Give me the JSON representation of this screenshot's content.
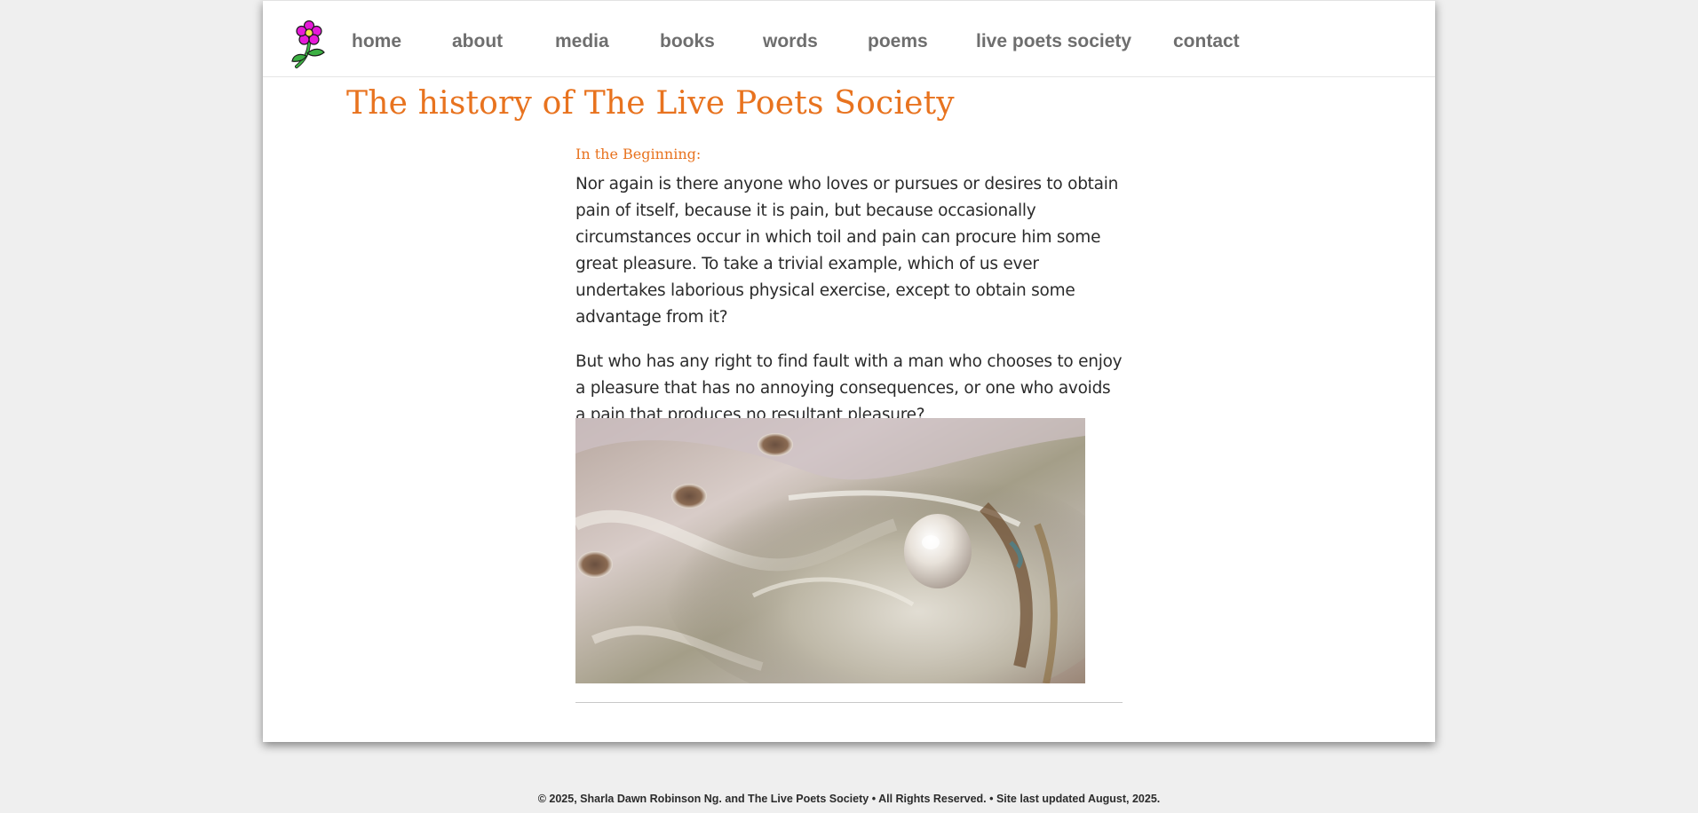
{
  "nav": {
    "logo_icon": "flower-icon",
    "items": [
      {
        "label": "home"
      },
      {
        "label": "about"
      },
      {
        "label": "media"
      },
      {
        "label": "books"
      },
      {
        "label": "words"
      },
      {
        "label": "poems"
      },
      {
        "label": "live poets society"
      },
      {
        "label": "contact"
      }
    ]
  },
  "main": {
    "title": "The history of The Live Poets Society",
    "section_heading": "In the Beginning:",
    "paragraphs": [
      "Nor again is there anyone who loves or pursues or desires to obtain pain of itself, because it is pain, but because occasionally circumstances occur in which toil and pain can procure him some great pleasure. To take a trivial example, which of us ever undertakes laborious physical exercise, except to obtain some advantage from it?",
      "But who has any right to find fault with a man who chooses to enjoy a pleasure that has no annoying consequences, or one who avoids a pain that produces no resultant pleasure?"
    ],
    "image_icon": "abalone-shell-with-pearl-photo"
  },
  "footer": {
    "text": "© 2025, Sharla Dawn Robinson Ng. and The Live Poets Society • All Rights Reserved. • Site last updated August, 2025."
  },
  "colors": {
    "accent": "#e8731f",
    "nav_text": "#6e6e6e",
    "body_text": "#2b2b2b",
    "background": "#efefef"
  }
}
